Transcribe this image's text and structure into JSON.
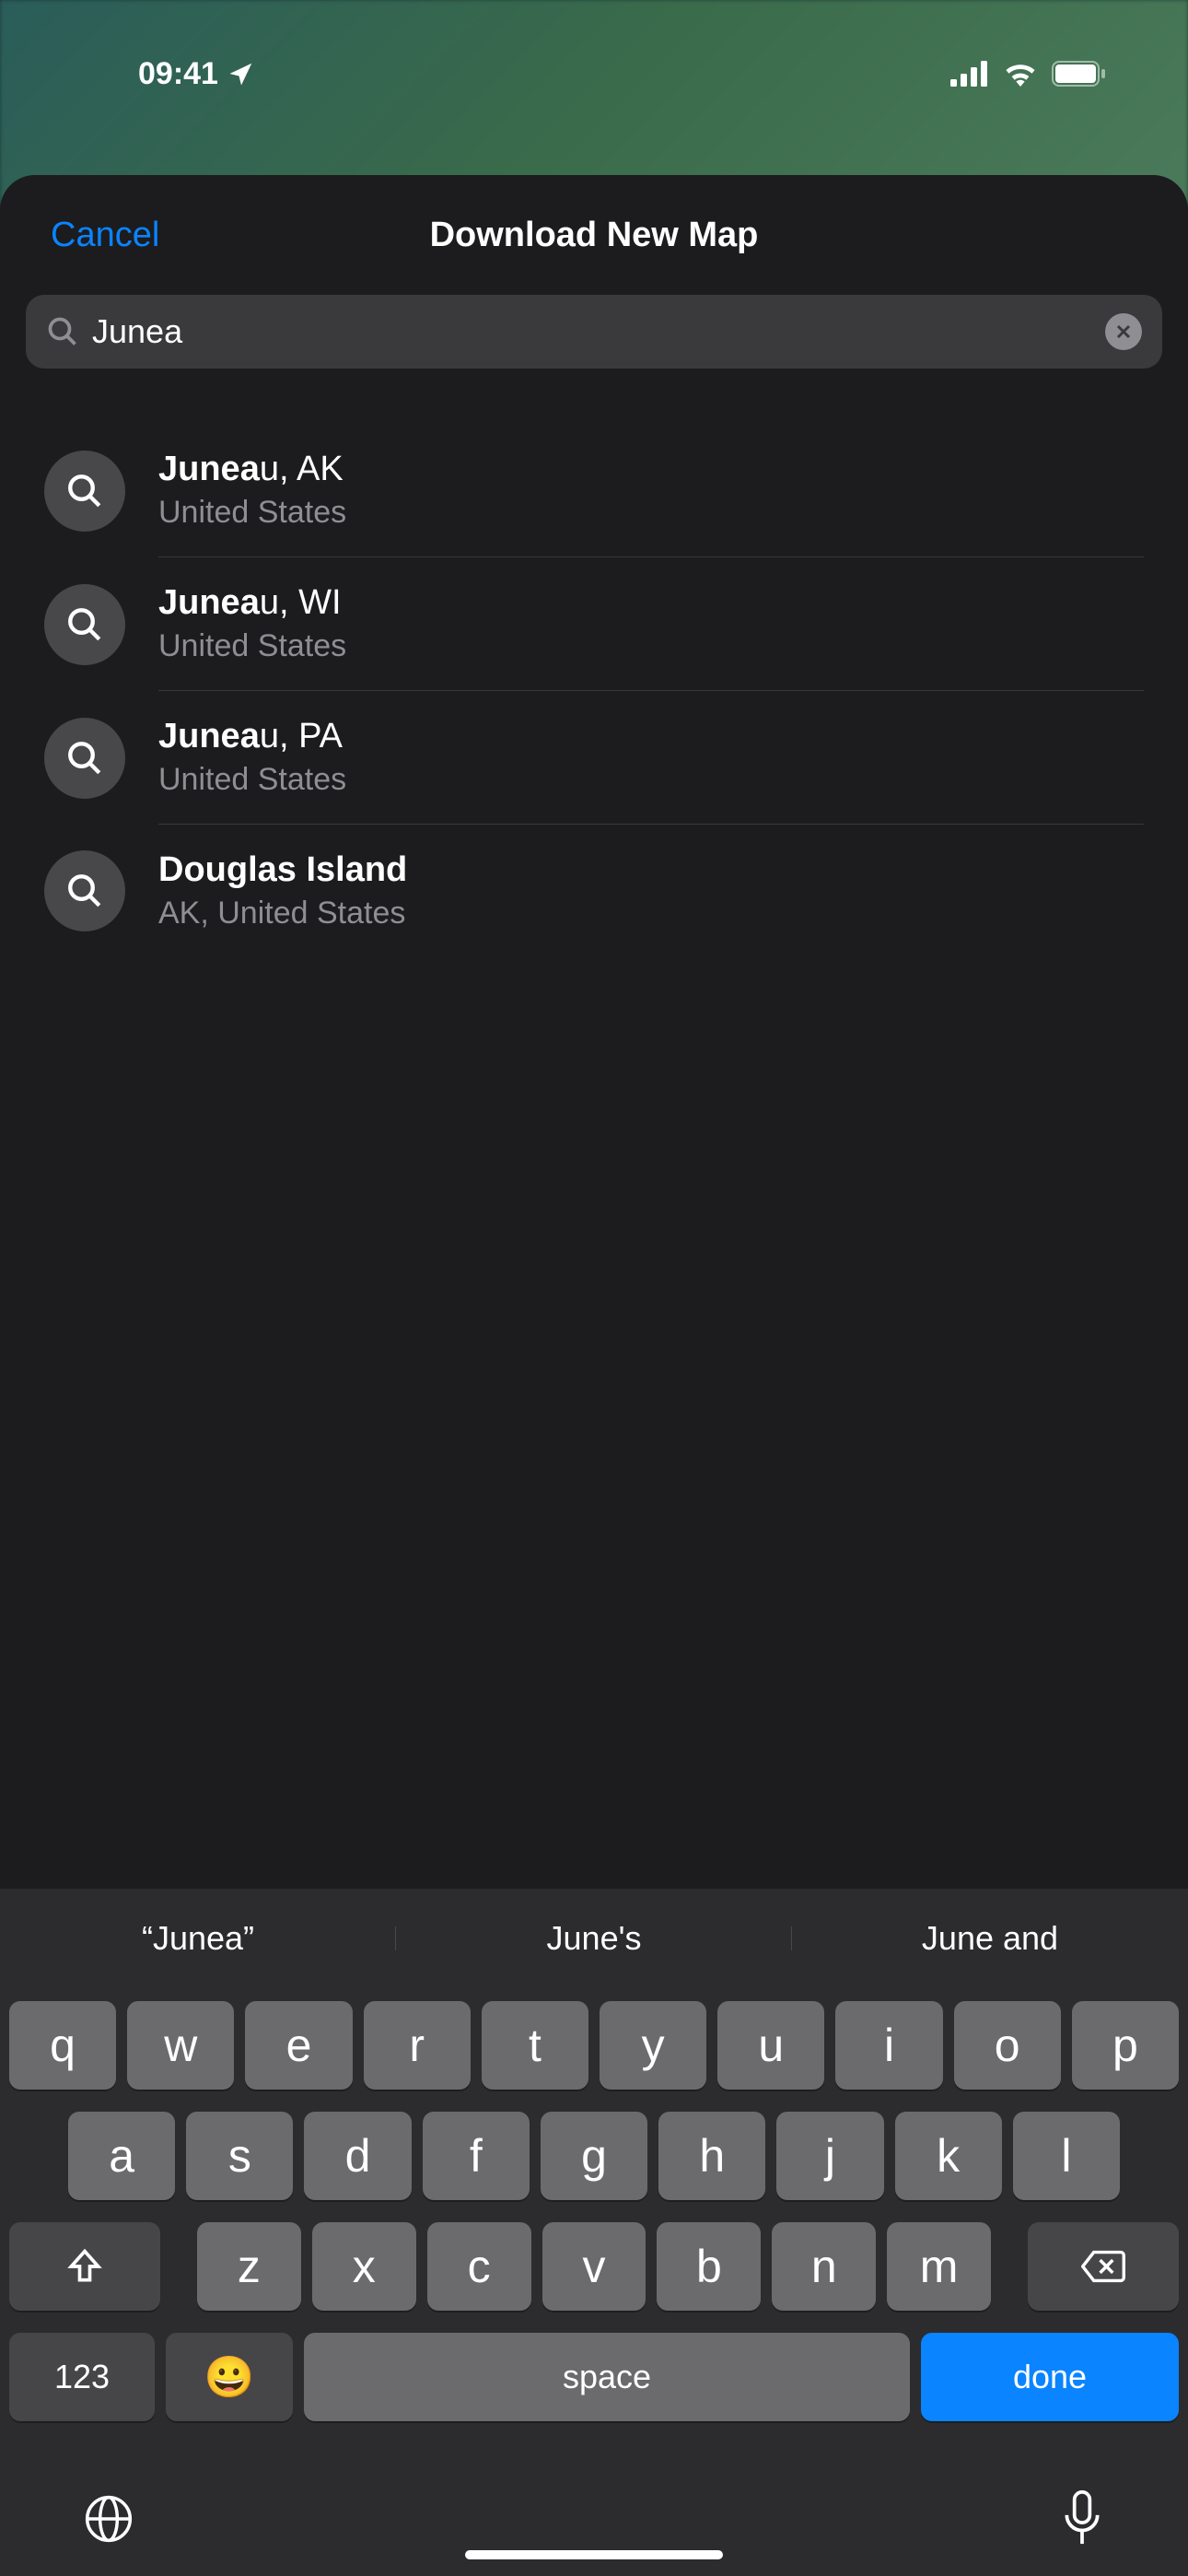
{
  "statusBar": {
    "time": "09:41"
  },
  "sheet": {
    "cancelLabel": "Cancel",
    "title": "Download New Map"
  },
  "search": {
    "value": "Junea"
  },
  "results": [
    {
      "titleBold": "Junea",
      "titleRest": "u, AK",
      "subtitle": "United States"
    },
    {
      "titleBold": "Junea",
      "titleRest": "u, WI",
      "subtitle": "United States"
    },
    {
      "titleBold": "Junea",
      "titleRest": "u, PA",
      "subtitle": "United States"
    },
    {
      "titleBold": "Douglas Island",
      "titleRest": "",
      "subtitle": "AK, United States"
    }
  ],
  "suggestions": [
    "“Junea”",
    "June's",
    "June and"
  ],
  "keyboard": {
    "row1": [
      "q",
      "w",
      "e",
      "r",
      "t",
      "y",
      "u",
      "i",
      "o",
      "p"
    ],
    "row2": [
      "a",
      "s",
      "d",
      "f",
      "g",
      "h",
      "j",
      "k",
      "l"
    ],
    "row3": [
      "z",
      "x",
      "c",
      "v",
      "b",
      "n",
      "m"
    ],
    "numKey": "123",
    "spaceLabel": "space",
    "doneLabel": "done"
  }
}
